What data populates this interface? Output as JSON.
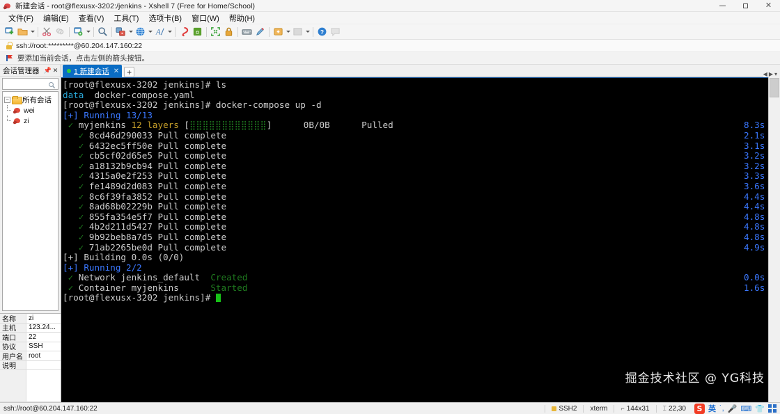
{
  "window": {
    "title": "新建会话 - root@flexusx-3202:/jenkins - Xshell 7 (Free for Home/School)",
    "app_icon": "xshell-icon",
    "minimize": "minimize-icon",
    "maximize": "maximize-icon",
    "close": "close-icon"
  },
  "menubar": {
    "items": [
      {
        "label": "文件(F)",
        "name": "menu-file"
      },
      {
        "label": "编辑(E)",
        "name": "menu-edit"
      },
      {
        "label": "查看(V)",
        "name": "menu-view"
      },
      {
        "label": "工具(T)",
        "name": "menu-tools"
      },
      {
        "label": "选项卡(B)",
        "name": "menu-tabs"
      },
      {
        "label": "窗口(W)",
        "name": "menu-window"
      },
      {
        "label": "帮助(H)",
        "name": "menu-help"
      }
    ]
  },
  "toolbar": {
    "icons": [
      "new-session-icon",
      "open-folder-icon",
      "folder-dropdown-caret",
      "separator",
      "scissors-icon",
      "link-icon",
      "separator",
      "session-settings-icon",
      "session-settings-caret",
      "separator",
      "find-icon",
      "separator",
      "transfer-icon",
      "transfer-caret",
      "globe-icon",
      "globe-caret",
      "font-icon",
      "font-caret",
      "separator",
      "ribbon-icon",
      "money-icon",
      "separator",
      "fullscreen-icon",
      "lock-icon",
      "separator",
      "keyboard-icon",
      "highlighter-icon",
      "separator",
      "package-icon",
      "package-caret",
      "layout-icon",
      "layout-caret",
      "separator",
      "help-icon",
      "comment-icon"
    ]
  },
  "address_bar": {
    "lock_icon": "lock-icon",
    "url": "ssh://root:*********@60.204.147.160:22"
  },
  "notice_bar": {
    "flag_icon": "flag-icon",
    "text": "要添加当前会话，点击左侧的箭头按钮。"
  },
  "session_manager": {
    "title": "会话管理器",
    "pin_icon": "pin-icon",
    "close_icon": "close-icon",
    "search_placeholder": "",
    "search_value": "",
    "search_icon": "search-icon",
    "tree": {
      "root_label": "所有会话",
      "root_expander": "−",
      "folder_icon": "folder-icon",
      "children": [
        {
          "label": "wei",
          "icon": "session-icon"
        },
        {
          "label": "zi",
          "icon": "session-icon"
        }
      ]
    },
    "properties": [
      {
        "key": "名称",
        "value": "zi"
      },
      {
        "key": "主机",
        "value": "123.24..."
      },
      {
        "key": "端口",
        "value": "22"
      },
      {
        "key": "协议",
        "value": "SSH"
      },
      {
        "key": "用户名",
        "value": "root"
      },
      {
        "key": "说明",
        "value": ""
      }
    ]
  },
  "tabs": {
    "items": [
      {
        "label": "1 新建会话",
        "status_dot": "connected-dot",
        "close_icon": "close-icon"
      }
    ],
    "new_tab_label": "+",
    "nav_prev": "◀",
    "nav_next": "▶",
    "nav_menu": "▾"
  },
  "terminal": {
    "watermark": "掘金技术社区 @ YG科技",
    "cursor": "block-cursor",
    "lines": [
      {
        "segs": [
          {
            "t": "[root@flexusx-3202 jenkins]# ls",
            "c": "c-white"
          }
        ]
      },
      {
        "segs": [
          {
            "t": "data",
            "c": "c-cyan"
          },
          {
            "t": "  docker-compose.yaml",
            "c": "c-white"
          }
        ]
      },
      {
        "segs": [
          {
            "t": "[root@flexusx-3202 jenkins]# docker-compose up -d",
            "c": "c-white"
          }
        ]
      },
      {
        "segs": [
          {
            "t": "[+] Running 13/13",
            "c": "c-blue"
          }
        ]
      },
      {
        "segs": [
          {
            "t": " ",
            "c": "c-white"
          },
          {
            "t": "✓",
            "c": "c-dgreen"
          },
          {
            "t": " myjenkins ",
            "c": "c-white"
          },
          {
            "t": "12 layers",
            "c": "c-yellow"
          },
          {
            "t": " [",
            "c": "c-white"
          },
          {
            "t": "⣿⣿⣿⣿⣿⣿⣿⣿⣿⣿⣿⣿",
            "c": "c-dgreen"
          },
          {
            "t": "]      0B/0B      Pulled",
            "c": "c-white"
          }
        ],
        "time": "8.3s"
      },
      {
        "segs": [
          {
            "t": "   ",
            "c": "c-white"
          },
          {
            "t": "✓",
            "c": "c-dgreen"
          },
          {
            "t": " 8cd46d290033 Pull complete",
            "c": "c-white"
          }
        ],
        "time": "2.1s"
      },
      {
        "segs": [
          {
            "t": "   ",
            "c": "c-white"
          },
          {
            "t": "✓",
            "c": "c-dgreen"
          },
          {
            "t": " 6432ec5ff50e Pull complete",
            "c": "c-white"
          }
        ],
        "time": "3.1s"
      },
      {
        "segs": [
          {
            "t": "   ",
            "c": "c-white"
          },
          {
            "t": "✓",
            "c": "c-dgreen"
          },
          {
            "t": " cb5cf02d65e5 Pull complete",
            "c": "c-white"
          }
        ],
        "time": "3.2s"
      },
      {
        "segs": [
          {
            "t": "   ",
            "c": "c-white"
          },
          {
            "t": "✓",
            "c": "c-dgreen"
          },
          {
            "t": " a18132b9cb94 Pull complete",
            "c": "c-white"
          }
        ],
        "time": "3.2s"
      },
      {
        "segs": [
          {
            "t": "   ",
            "c": "c-white"
          },
          {
            "t": "✓",
            "c": "c-dgreen"
          },
          {
            "t": " 4315a0e2f253 Pull complete",
            "c": "c-white"
          }
        ],
        "time": "3.3s"
      },
      {
        "segs": [
          {
            "t": "   ",
            "c": "c-white"
          },
          {
            "t": "✓",
            "c": "c-dgreen"
          },
          {
            "t": " fe1489d2d083 Pull complete",
            "c": "c-white"
          }
        ],
        "time": "3.6s"
      },
      {
        "segs": [
          {
            "t": "   ",
            "c": "c-white"
          },
          {
            "t": "✓",
            "c": "c-dgreen"
          },
          {
            "t": " 8c6f39fa3852 Pull complete",
            "c": "c-white"
          }
        ],
        "time": "4.4s"
      },
      {
        "segs": [
          {
            "t": "   ",
            "c": "c-white"
          },
          {
            "t": "✓",
            "c": "c-dgreen"
          },
          {
            "t": " 8ad68b02229b Pull complete",
            "c": "c-white"
          }
        ],
        "time": "4.4s"
      },
      {
        "segs": [
          {
            "t": "   ",
            "c": "c-white"
          },
          {
            "t": "✓",
            "c": "c-dgreen"
          },
          {
            "t": " 855fa354e5f7 Pull complete",
            "c": "c-white"
          }
        ],
        "time": "4.8s"
      },
      {
        "segs": [
          {
            "t": "   ",
            "c": "c-white"
          },
          {
            "t": "✓",
            "c": "c-dgreen"
          },
          {
            "t": " 4b2d211d5427 Pull complete",
            "c": "c-white"
          }
        ],
        "time": "4.8s"
      },
      {
        "segs": [
          {
            "t": "   ",
            "c": "c-white"
          },
          {
            "t": "✓",
            "c": "c-dgreen"
          },
          {
            "t": " 9b92beb8a7d5 Pull complete",
            "c": "c-white"
          }
        ],
        "time": "4.8s"
      },
      {
        "segs": [
          {
            "t": "   ",
            "c": "c-white"
          },
          {
            "t": "✓",
            "c": "c-dgreen"
          },
          {
            "t": " 71ab2265be0d Pull complete",
            "c": "c-white"
          }
        ],
        "time": "4.9s"
      },
      {
        "segs": [
          {
            "t": "[+] Building 0.0s (0/0)",
            "c": "c-white"
          }
        ]
      },
      {
        "segs": [
          {
            "t": "[+] Running 2/2",
            "c": "c-blue"
          }
        ]
      },
      {
        "segs": [
          {
            "t": " ",
            "c": "c-white"
          },
          {
            "t": "✓",
            "c": "c-dgreen"
          },
          {
            "t": " Network jenkins_default  ",
            "c": "c-white"
          },
          {
            "t": "Created",
            "c": "c-dgreen"
          }
        ],
        "time": "0.0s"
      },
      {
        "segs": [
          {
            "t": " ",
            "c": "c-white"
          },
          {
            "t": "✓",
            "c": "c-dgreen"
          },
          {
            "t": " Container myjenkins      ",
            "c": "c-white"
          },
          {
            "t": "Started",
            "c": "c-dgreen"
          }
        ],
        "time": "1.6s"
      },
      {
        "segs": [
          {
            "t": "[root@flexusx-3202 jenkins]# ",
            "c": "c-white"
          }
        ],
        "cursor": true
      }
    ]
  },
  "statusbar": {
    "connection": "ssh://root@60.204.147.160:22",
    "protocol": "SSH2",
    "terminal_type": "xterm",
    "size_icon": "resize-icon",
    "size": "144x31",
    "cursor_icon": "cursor-icon",
    "cursor_pos": "22,30",
    "tray": [
      "sogou-icon",
      "chinese-input-icon",
      "punctuation-icon",
      "mic-icon",
      "keyboard-icon",
      "tshirt-icon",
      "grid-icon"
    ]
  },
  "colors": {
    "accent": "#0a6cc4",
    "terminal_bg": "#000000",
    "terminal_fg": "#cccccc",
    "blue": "#3b78ff",
    "cyan": "#2aa8d8",
    "green": "#17c217",
    "yellow": "#c8a02a"
  }
}
